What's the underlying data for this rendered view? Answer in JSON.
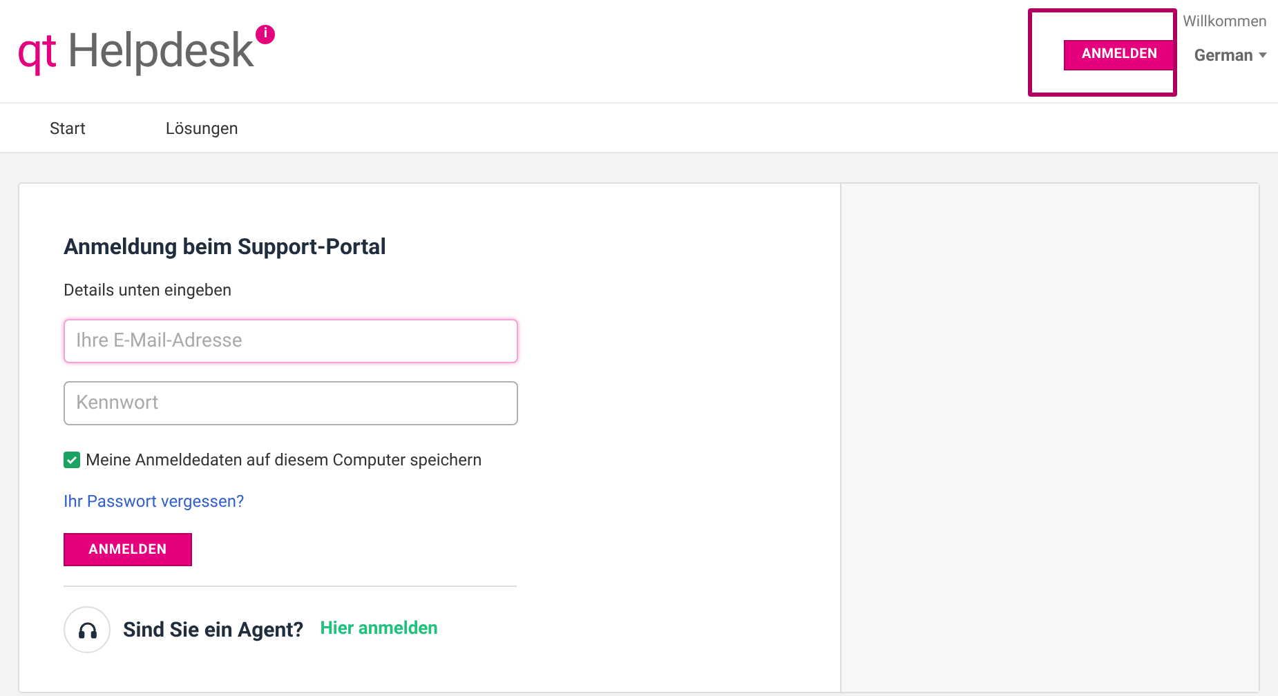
{
  "header": {
    "logo_prefix": "qt",
    "logo_name": "Helpdesk",
    "logo_badge": "i",
    "greeting": "Willkommen",
    "login_button": "ANMELDEN",
    "language": "German",
    "highlighted": true
  },
  "nav": [
    {
      "label": "Start"
    },
    {
      "label": "Lösungen"
    }
  ],
  "login": {
    "title": "Anmeldung beim Support-Portal",
    "subtitle": "Details unten eingeben",
    "email": {
      "placeholder": "Ihre E-Mail-Adresse",
      "focused": true
    },
    "password": {
      "placeholder": "Kennwort",
      "focused": false
    },
    "remember": {
      "label": "Meine Anmeldedaten auf diesem Computer speichern",
      "checked": true
    },
    "forgot_link": "Ihr Passwort vergessen?",
    "submit": "ANMELDEN",
    "agent_question": "Sind Sie ein Agent?",
    "agent_link": "Hier anmelden"
  }
}
